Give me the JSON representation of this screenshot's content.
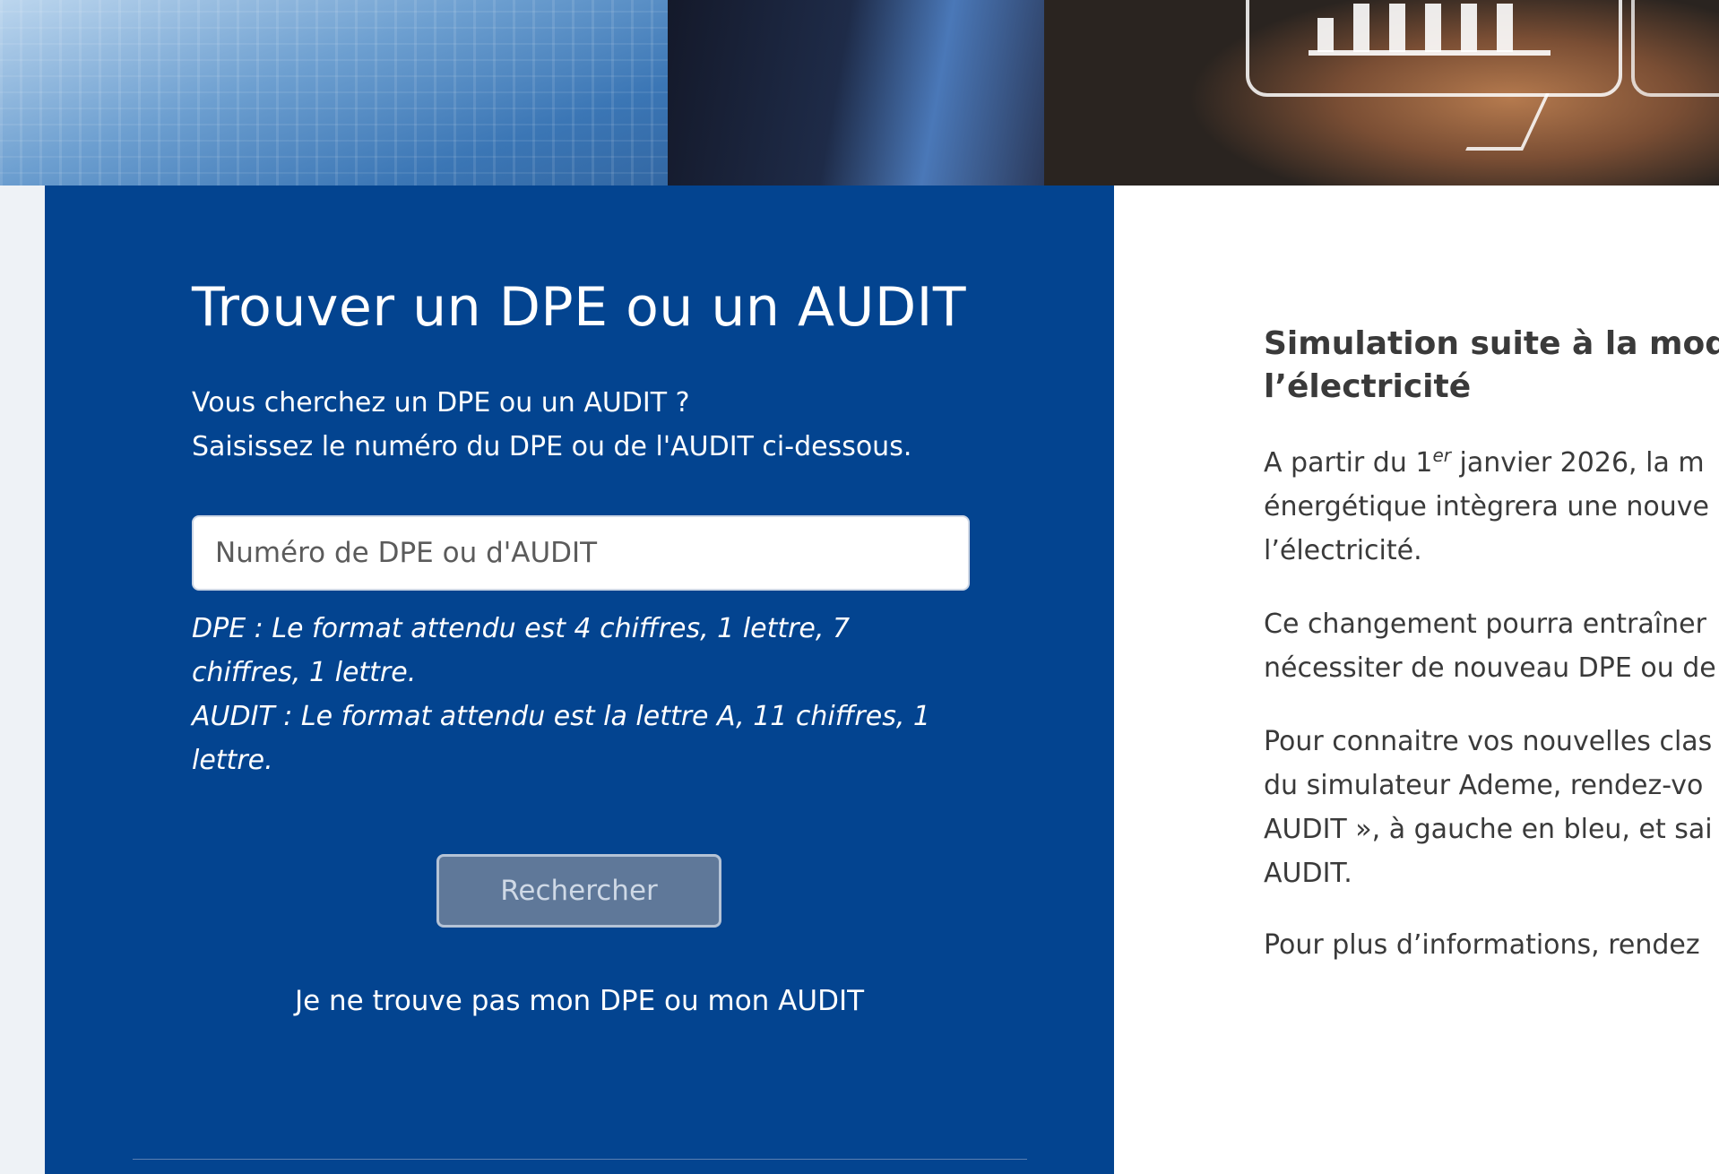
{
  "search_card": {
    "title": "Trouver un DPE ou un AUDIT",
    "intro_line1": "Vous cherchez un DPE ou un AUDIT ?",
    "intro_line2": "Saisissez le numéro du DPE ou de l'AUDIT ci-dessous.",
    "input_placeholder": "Numéro de DPE ou d'AUDIT",
    "input_value": "",
    "help_dpe_line1": "DPE : Le format attendu est 4 chiffres, 1 lettre, 7",
    "help_dpe_line2": "chiffres, 1 lettre.",
    "help_audit_line1": "AUDIT : Le format attendu est la lettre A, 11 chiffres, 1",
    "help_audit_line2": "lettre.",
    "search_button": "Rechercher",
    "not_found_link": "Je ne trouve pas mon DPE ou mon AUDIT"
  },
  "info_panel": {
    "title_line1": "Simulation suite à la modif",
    "title_line2": "l’électricité",
    "p1_line1_before": "A partir du 1",
    "p1_line1_sup": "er",
    "p1_line1_after": " janvier 2026, la m",
    "p1_line2": "énergétique intègrera une nouve",
    "p1_line3": "l’électricité.",
    "p2_line1": "Ce changement pourra entraîner",
    "p2_line2": "nécessiter de nouveau DPE ou de",
    "p3_line1": "Pour connaitre vos nouvelles clas",
    "p3_line2": "du simulateur Ademe, rendez-vo",
    "p3_line3": "AUDIT », à gauche en bleu, et sai",
    "p3_line4": "AUDIT.",
    "p4_line1": "Pour plus d’informations, rendez"
  },
  "colors": {
    "card_blue": "#034490",
    "button_disabled": "#5f7899",
    "text_dark": "#3a3a3a"
  },
  "icons": {
    "hero": "hero-banner-image",
    "chart_bubble": "bar-chart-bubble-icon"
  }
}
